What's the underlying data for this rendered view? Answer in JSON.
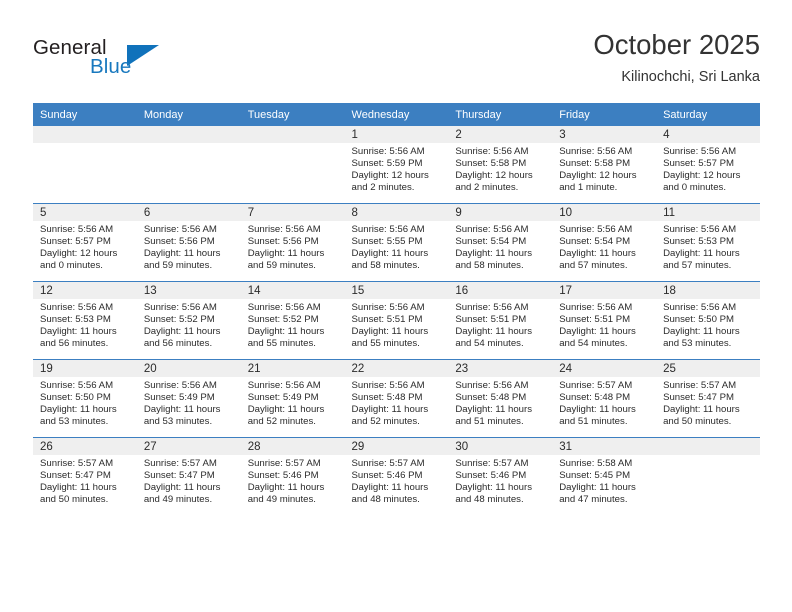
{
  "brand": {
    "name_top": "General",
    "name_bottom": "Blue",
    "accent_color": "#1072bb",
    "triangle_icon": "triangle-icon"
  },
  "header": {
    "title": "October 2025",
    "subtitle": "Kilinochchi, Sri Lanka"
  },
  "calendar": {
    "header_bg": "#3c7fc1",
    "daynum_bg": "#efefef",
    "weekday_headers": [
      "Sunday",
      "Monday",
      "Tuesday",
      "Wednesday",
      "Thursday",
      "Friday",
      "Saturday"
    ],
    "weeks": [
      [
        {
          "day": "",
          "lines": []
        },
        {
          "day": "",
          "lines": []
        },
        {
          "day": "",
          "lines": []
        },
        {
          "day": "1",
          "lines": [
            "Sunrise: 5:56 AM",
            "Sunset: 5:59 PM",
            "Daylight: 12 hours and 2 minutes."
          ]
        },
        {
          "day": "2",
          "lines": [
            "Sunrise: 5:56 AM",
            "Sunset: 5:58 PM",
            "Daylight: 12 hours and 2 minutes."
          ]
        },
        {
          "day": "3",
          "lines": [
            "Sunrise: 5:56 AM",
            "Sunset: 5:58 PM",
            "Daylight: 12 hours and 1 minute."
          ]
        },
        {
          "day": "4",
          "lines": [
            "Sunrise: 5:56 AM",
            "Sunset: 5:57 PM",
            "Daylight: 12 hours and 0 minutes."
          ]
        }
      ],
      [
        {
          "day": "5",
          "lines": [
            "Sunrise: 5:56 AM",
            "Sunset: 5:57 PM",
            "Daylight: 12 hours and 0 minutes."
          ]
        },
        {
          "day": "6",
          "lines": [
            "Sunrise: 5:56 AM",
            "Sunset: 5:56 PM",
            "Daylight: 11 hours and 59 minutes."
          ]
        },
        {
          "day": "7",
          "lines": [
            "Sunrise: 5:56 AM",
            "Sunset: 5:56 PM",
            "Daylight: 11 hours and 59 minutes."
          ]
        },
        {
          "day": "8",
          "lines": [
            "Sunrise: 5:56 AM",
            "Sunset: 5:55 PM",
            "Daylight: 11 hours and 58 minutes."
          ]
        },
        {
          "day": "9",
          "lines": [
            "Sunrise: 5:56 AM",
            "Sunset: 5:54 PM",
            "Daylight: 11 hours and 58 minutes."
          ]
        },
        {
          "day": "10",
          "lines": [
            "Sunrise: 5:56 AM",
            "Sunset: 5:54 PM",
            "Daylight: 11 hours and 57 minutes."
          ]
        },
        {
          "day": "11",
          "lines": [
            "Sunrise: 5:56 AM",
            "Sunset: 5:53 PM",
            "Daylight: 11 hours and 57 minutes."
          ]
        }
      ],
      [
        {
          "day": "12",
          "lines": [
            "Sunrise: 5:56 AM",
            "Sunset: 5:53 PM",
            "Daylight: 11 hours and 56 minutes."
          ]
        },
        {
          "day": "13",
          "lines": [
            "Sunrise: 5:56 AM",
            "Sunset: 5:52 PM",
            "Daylight: 11 hours and 56 minutes."
          ]
        },
        {
          "day": "14",
          "lines": [
            "Sunrise: 5:56 AM",
            "Sunset: 5:52 PM",
            "Daylight: 11 hours and 55 minutes."
          ]
        },
        {
          "day": "15",
          "lines": [
            "Sunrise: 5:56 AM",
            "Sunset: 5:51 PM",
            "Daylight: 11 hours and 55 minutes."
          ]
        },
        {
          "day": "16",
          "lines": [
            "Sunrise: 5:56 AM",
            "Sunset: 5:51 PM",
            "Daylight: 11 hours and 54 minutes."
          ]
        },
        {
          "day": "17",
          "lines": [
            "Sunrise: 5:56 AM",
            "Sunset: 5:51 PM",
            "Daylight: 11 hours and 54 minutes."
          ]
        },
        {
          "day": "18",
          "lines": [
            "Sunrise: 5:56 AM",
            "Sunset: 5:50 PM",
            "Daylight: 11 hours and 53 minutes."
          ]
        }
      ],
      [
        {
          "day": "19",
          "lines": [
            "Sunrise: 5:56 AM",
            "Sunset: 5:50 PM",
            "Daylight: 11 hours and 53 minutes."
          ]
        },
        {
          "day": "20",
          "lines": [
            "Sunrise: 5:56 AM",
            "Sunset: 5:49 PM",
            "Daylight: 11 hours and 53 minutes."
          ]
        },
        {
          "day": "21",
          "lines": [
            "Sunrise: 5:56 AM",
            "Sunset: 5:49 PM",
            "Daylight: 11 hours and 52 minutes."
          ]
        },
        {
          "day": "22",
          "lines": [
            "Sunrise: 5:56 AM",
            "Sunset: 5:48 PM",
            "Daylight: 11 hours and 52 minutes."
          ]
        },
        {
          "day": "23",
          "lines": [
            "Sunrise: 5:56 AM",
            "Sunset: 5:48 PM",
            "Daylight: 11 hours and 51 minutes."
          ]
        },
        {
          "day": "24",
          "lines": [
            "Sunrise: 5:57 AM",
            "Sunset: 5:48 PM",
            "Daylight: 11 hours and 51 minutes."
          ]
        },
        {
          "day": "25",
          "lines": [
            "Sunrise: 5:57 AM",
            "Sunset: 5:47 PM",
            "Daylight: 11 hours and 50 minutes."
          ]
        }
      ],
      [
        {
          "day": "26",
          "lines": [
            "Sunrise: 5:57 AM",
            "Sunset: 5:47 PM",
            "Daylight: 11 hours and 50 minutes."
          ]
        },
        {
          "day": "27",
          "lines": [
            "Sunrise: 5:57 AM",
            "Sunset: 5:47 PM",
            "Daylight: 11 hours and 49 minutes."
          ]
        },
        {
          "day": "28",
          "lines": [
            "Sunrise: 5:57 AM",
            "Sunset: 5:46 PM",
            "Daylight: 11 hours and 49 minutes."
          ]
        },
        {
          "day": "29",
          "lines": [
            "Sunrise: 5:57 AM",
            "Sunset: 5:46 PM",
            "Daylight: 11 hours and 48 minutes."
          ]
        },
        {
          "day": "30",
          "lines": [
            "Sunrise: 5:57 AM",
            "Sunset: 5:46 PM",
            "Daylight: 11 hours and 48 minutes."
          ]
        },
        {
          "day": "31",
          "lines": [
            "Sunrise: 5:58 AM",
            "Sunset: 5:45 PM",
            "Daylight: 11 hours and 47 minutes."
          ]
        },
        {
          "day": "",
          "lines": []
        }
      ]
    ]
  }
}
